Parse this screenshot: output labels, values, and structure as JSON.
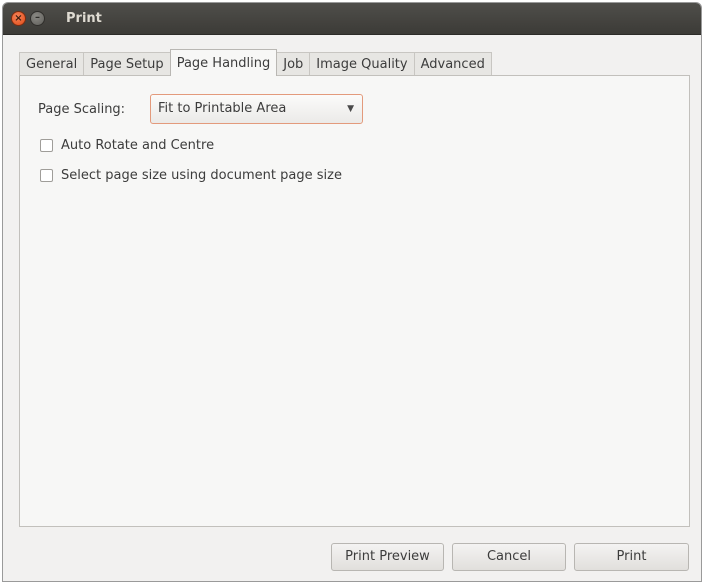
{
  "window": {
    "title": "Print",
    "close_glyph": "×",
    "minimize_glyph": "–"
  },
  "tabs": [
    {
      "label": "General",
      "active": false
    },
    {
      "label": "Page Setup",
      "active": false
    },
    {
      "label": "Page Handling",
      "active": true
    },
    {
      "label": "Job",
      "active": false
    },
    {
      "label": "Image Quality",
      "active": false
    },
    {
      "label": "Advanced",
      "active": false
    }
  ],
  "page_handling": {
    "scaling_label": "Page Scaling:",
    "scaling_value": "Fit to Printable Area",
    "auto_rotate_label": "Auto Rotate and Centre",
    "auto_rotate_checked": false,
    "select_page_size_label": "Select page size using document page size",
    "select_page_size_checked": false
  },
  "buttons": {
    "print_preview": "Print Preview",
    "cancel": "Cancel",
    "print": "Print"
  },
  "colors": {
    "titlebar": "#3c3b37",
    "close_button": "#df4a16",
    "window_bg": "#f2f1f0",
    "combo_focus_border": "#e39a7c"
  }
}
